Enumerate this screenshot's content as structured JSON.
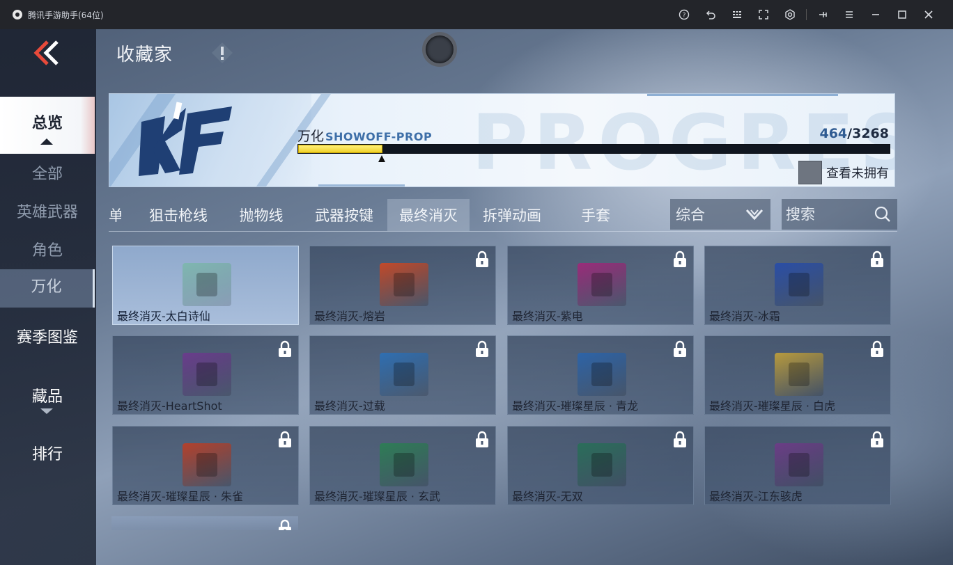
{
  "window": {
    "title": "腾讯手游助手(64位)"
  },
  "header": {
    "title": "收藏家"
  },
  "nav": {
    "items": [
      {
        "label": "总览"
      },
      {
        "label": "全部"
      },
      {
        "label": "英雄武器"
      },
      {
        "label": "角色"
      },
      {
        "label": "万化"
      },
      {
        "label": "赛季图鉴"
      },
      {
        "label": "藏品"
      },
      {
        "label": "排行"
      }
    ],
    "active_index": 0,
    "selected_index": 4
  },
  "banner": {
    "label": "万化",
    "sub_label": "SHOWOFF-PROP",
    "owned": "464",
    "total": "3268",
    "separator": "/",
    "progress_fraction": 0.142,
    "unowned_label": "查看未拥有",
    "watermark": "PROGRESS"
  },
  "tabs": [
    {
      "label": "单"
    },
    {
      "label": "狙击枪线"
    },
    {
      "label": "抛物线"
    },
    {
      "label": "武器按键"
    },
    {
      "label": "最终消灭"
    },
    {
      "label": "拆弹动画"
    },
    {
      "label": "手套"
    }
  ],
  "active_tab_index": 4,
  "sort": {
    "value": "综合"
  },
  "search": {
    "placeholder": "搜索"
  },
  "items": [
    {
      "name": "最终消灭-太白诗仙",
      "color": "#7fb7b0",
      "locked": false
    },
    {
      "name": "最终消灭-熔岩",
      "color": "#c24a2a",
      "locked": true
    },
    {
      "name": "最终消灭-紫电",
      "color": "#9a2c7a",
      "locked": true
    },
    {
      "name": "最终消灭-冰霜",
      "color": "#2a4ea6",
      "locked": true
    },
    {
      "name": "最终消灭-HeartShot",
      "color": "#6a3d8c",
      "locked": true
    },
    {
      "name": "最终消灭-过载",
      "color": "#2f6fb2",
      "locked": true
    },
    {
      "name": "最终消灭-璀璨星辰 · 青龙",
      "color": "#2d64a8",
      "locked": true
    },
    {
      "name": "最终消灭-璀璨星辰 · 白虎",
      "color": "#b79a3e",
      "locked": true
    },
    {
      "name": "最终消灭-璀璨星辰 · 朱雀",
      "color": "#b3412c",
      "locked": true
    },
    {
      "name": "最终消灭-璀璨星辰 · 玄武",
      "color": "#2e7d56",
      "locked": true
    },
    {
      "name": "最终消灭-无双",
      "color": "#2a6e5a",
      "locked": true
    },
    {
      "name": "最终消灭-江东骇虎",
      "color": "#6b3d86",
      "locked": true
    }
  ],
  "icons": {
    "help": "help-icon",
    "undo": "undo-icon",
    "keyboard": "keyboard-icon",
    "fullscreen": "fullscreen-icon",
    "settings": "settings-icon",
    "pin": "pin-icon",
    "menu": "menu-icon",
    "minimize": "minimize-icon",
    "maximize": "maximize-icon",
    "close": "close-icon"
  },
  "colors": {
    "accent_red": "#e84a3a",
    "progress_yellow": "#f0d12a",
    "banner_blue": "#2f5b92"
  }
}
